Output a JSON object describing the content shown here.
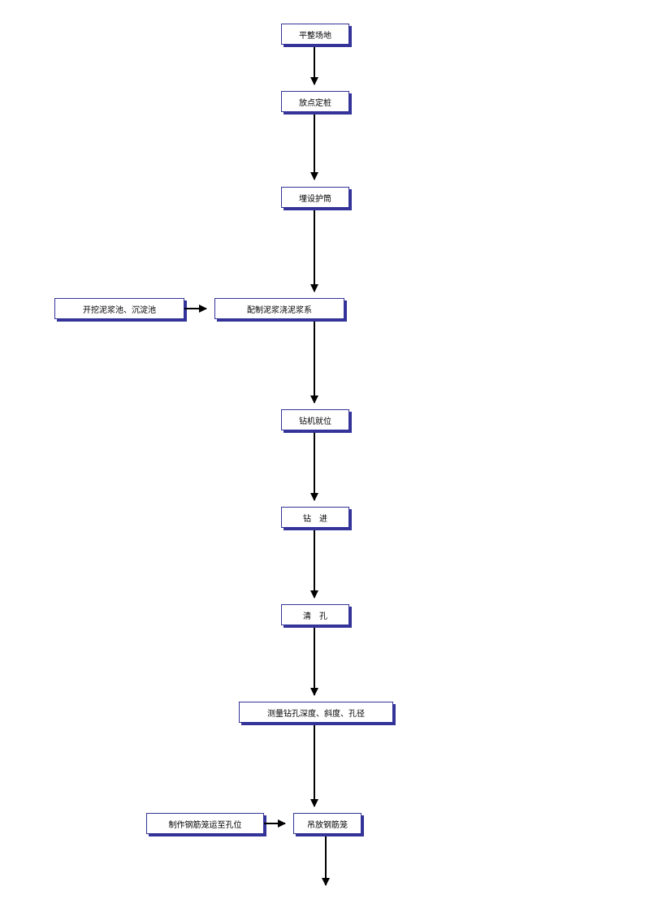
{
  "nodes": {
    "n1": "平整场地",
    "n2": "放点定桩",
    "n3": "埋设护筒",
    "n4_left": "开挖泥浆池、沉淀池",
    "n4_right": "配制泥浆浇泥浆系",
    "n5": "钻机就位",
    "n6": "钻    进",
    "n7": "清    孔",
    "n8": "测量钻孔深度、斜度、孔径",
    "n9_left": "制作钢筋笼运至孔位",
    "n9_right": "吊放钢筋笼"
  },
  "layout": {
    "colCenter": 294,
    "sideCenter": 132,
    "boxH": 26,
    "shadowOffset": 3
  }
}
